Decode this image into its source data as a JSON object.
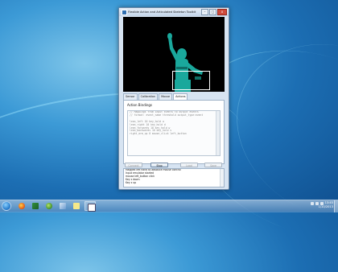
{
  "window": {
    "title": "Flexible Action and Articulated Skeleton Toolkit",
    "minimize_label": "–",
    "maximize_label": "□",
    "close_label": "x"
  },
  "tabs": [
    "Sensor",
    "Calibration",
    "Mouse",
    "Actions"
  ],
  "actions_panel": {
    "section_title": "Action Bindings",
    "bindings": [
      "// Mappings from input events to output events",
      "// format: event_name threshold output_type:event",
      "",
      "lean_left 10 key_hold a",
      "lean_right 10 key_hold d",
      "lean_forwards 10 key_hold w",
      "lean_backwards 10 key_hold s",
      "right_arm_up 0 mouse_click left_button"
    ]
  },
  "buttons": {
    "connect": "Connect",
    "stop": "Stop Emulator",
    "load": "Load",
    "save": "Save"
  },
  "log": [
    "Mapped left hand to absolute mouse control",
    "Input emulator started",
    "mouse left_button click",
    "Key z down",
    "Key z up"
  ],
  "taskbar": {
    "clock_time": "13:45",
    "clock_date": "1/10/2013"
  },
  "colors": {
    "silhouette": "#1aa89c",
    "viewport_background": "#000000",
    "desktop": "#1c6eb3"
  },
  "icons": [
    "start-orb-icon",
    "firefox-icon",
    "green-flag-icon",
    "earth-icon",
    "eraser-icon",
    "notes-icon",
    "app-window-icon",
    "speaker-icon",
    "network-icon",
    "flag-icon"
  ]
}
